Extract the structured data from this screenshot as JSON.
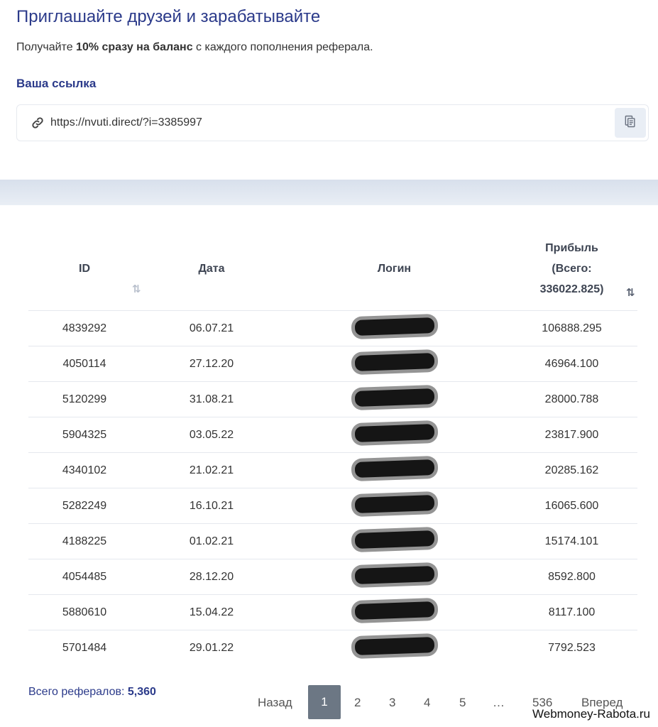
{
  "header": {
    "title": "Приглашайте друзей и зарабатывайте",
    "subtitle_pre": "Получайте ",
    "subtitle_bold": "10% сразу на баланс",
    "subtitle_post": " с каждого пополнения реферала."
  },
  "referral_link": {
    "label": "Ваша ссылка",
    "url": "https://nvuti.direct/?i=3385997",
    "link_icon": "link-icon",
    "copy_icon": "copy-icon"
  },
  "table": {
    "columns": {
      "id": "ID",
      "date": "Дата",
      "login": "Логин",
      "profit_line1": "Прибыль",
      "profit_line2": "(Всего:",
      "profit_line3": "336022.825)"
    },
    "sort_icon": "⇅",
    "rows": [
      {
        "id": "4839292",
        "date": "06.07.21",
        "profit": "106888.295"
      },
      {
        "id": "4050114",
        "date": "27.12.20",
        "profit": "46964.100"
      },
      {
        "id": "5120299",
        "date": "31.08.21",
        "profit": "28000.788"
      },
      {
        "id": "5904325",
        "date": "03.05.22",
        "profit": "23817.900"
      },
      {
        "id": "4340102",
        "date": "21.02.21",
        "profit": "20285.162"
      },
      {
        "id": "5282249",
        "date": "16.10.21",
        "profit": "16065.600"
      },
      {
        "id": "4188225",
        "date": "01.02.21",
        "profit": "15174.101"
      },
      {
        "id": "4054485",
        "date": "28.12.20",
        "profit": "8592.800"
      },
      {
        "id": "5880610",
        "date": "15.04.22",
        "profit": "8117.100"
      },
      {
        "id": "5701484",
        "date": "29.01.22",
        "profit": "7792.523"
      }
    ]
  },
  "footer": {
    "total_label": "Всего рефералов: ",
    "total_value": "5,360"
  },
  "pagination": {
    "prev": "Назад",
    "pages": [
      "1",
      "2",
      "3",
      "4",
      "5"
    ],
    "ellipsis": "…",
    "last": "536",
    "next": "Вперед",
    "current": "1"
  },
  "watermark": "Webmoney-Rabota.ru"
}
